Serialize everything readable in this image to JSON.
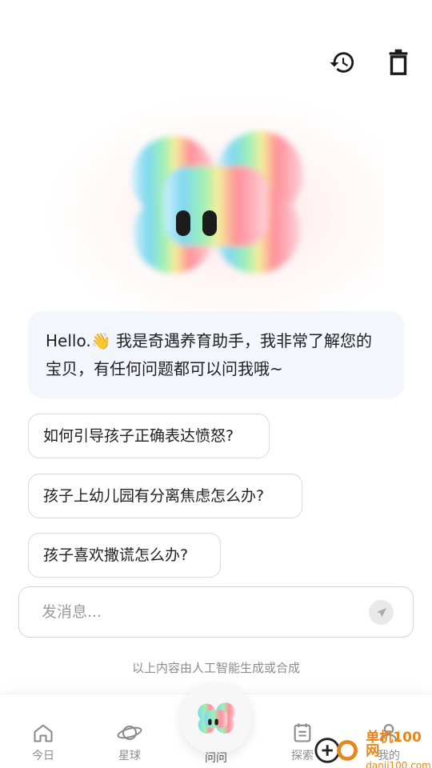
{
  "header": {
    "history_icon": "history-icon",
    "delete_icon": "trash-icon"
  },
  "assistant": {
    "greeting": "Hello.👋 我是奇遇养育助手，我非常了解您的宝贝，有任何问题都可以问我哦~"
  },
  "suggestions": [
    {
      "label": "如何引导孩子正确表达愤怒?"
    },
    {
      "label": "孩子上幼儿园有分离焦虑怎么办?"
    },
    {
      "label": "孩子喜欢撒谎怎么办?"
    }
  ],
  "composer": {
    "placeholder": "发消息...",
    "send_icon": "send-icon"
  },
  "disclaimer": "以上内容由人工智能生成或合成",
  "tabbar": {
    "items": [
      {
        "label": "今日",
        "icon": "home-icon"
      },
      {
        "label": "星球",
        "icon": "planet-icon"
      },
      {
        "label": "问问",
        "icon": "mascot-icon"
      },
      {
        "label": "探索",
        "icon": "notebook-icon"
      },
      {
        "label": "我的",
        "icon": "user-icon"
      }
    ]
  },
  "watermark": {
    "title": "单机100网",
    "url": "danji100.com"
  }
}
